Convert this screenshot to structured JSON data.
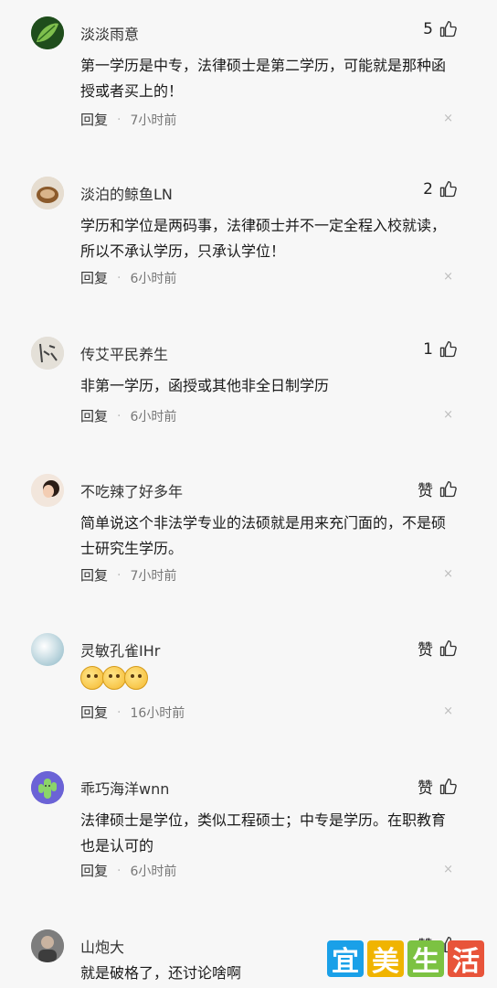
{
  "comments": [
    {
      "username": "淡淡雨意",
      "likes": "5",
      "text": "第一学历是中专，法律硕士是第二学历，可能就是那种函授或者买上的！",
      "reply": "回复",
      "time": "7小时前",
      "avatar_color": "#2f6b2a"
    },
    {
      "username": "淡泊的鲸鱼LN",
      "likes": "2",
      "text": "学历和学位是两码事，法律硕士并不一定全程入校就读，所以不承认学历，只承认学位！",
      "reply": "回复",
      "time": "6小时前",
      "avatar_color": "#b08d6a"
    },
    {
      "username": "传艾平民养生",
      "likes": "1",
      "text": "非第一学历，函授或其他非全日制学历",
      "reply": "回复",
      "time": "6小时前",
      "avatar_color": "#d8d4cc"
    },
    {
      "username": "不吃辣了好多年",
      "likes": "赞",
      "text": "简单说这个非法学专业的法硕就是用来充门面的，不是硕士研究生学历。",
      "reply": "回复",
      "time": "7小时前",
      "avatar_color": "#e9d2c2"
    },
    {
      "username": "灵敏孔雀IHr",
      "likes": "赞",
      "text": "",
      "reply": "回复",
      "time": "16小时前",
      "avatar_color": "#c9dde3"
    },
    {
      "username": "乖巧海洋wnn",
      "likes": "赞",
      "text": "法律硕士是学位，类似工程硕士；中专是学历。在职教育也是认可的",
      "reply": "回复",
      "time": "6小时前",
      "avatar_color": "#6a5acd"
    },
    {
      "username": "山炮大",
      "likes": "赞",
      "text": "就是破格了，还讨论啥啊",
      "reply": "",
      "time": "",
      "avatar_color": "#8a8a8a"
    }
  ],
  "close_glyph": "×",
  "watermark": {
    "chars": [
      "宜",
      "美",
      "生",
      "活"
    ],
    "colors": [
      "#1aa0e8",
      "#f0b400",
      "#7cc242",
      "#e8543a"
    ]
  }
}
